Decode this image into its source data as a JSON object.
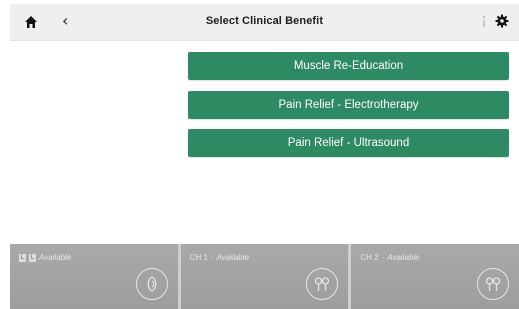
{
  "header": {
    "title": "Select Clinical Benefit",
    "home_icon": "home-icon",
    "back_icon": "back-chevron-icon",
    "back_glyph": "‹",
    "info_icon": "info-icon",
    "settings_icon": "gear-icon"
  },
  "menu": {
    "items": [
      {
        "label": "Muscle Re-Education"
      },
      {
        "label": "Pain Relief - Electrotherapy"
      },
      {
        "label": "Pain Relief - Ultrasound"
      }
    ],
    "button_color": "#2e8a62"
  },
  "channels": [
    {
      "badges": [
        "L",
        "L"
      ],
      "status": "Available",
      "icon": "ultrasound-head-icon"
    },
    {
      "name": "CH 1",
      "separator": "·",
      "status": "Available",
      "icon": "electrode-leads-icon"
    },
    {
      "name": "CH 2",
      "separator": "·",
      "status": "Available",
      "icon": "electrode-leads-icon"
    }
  ]
}
